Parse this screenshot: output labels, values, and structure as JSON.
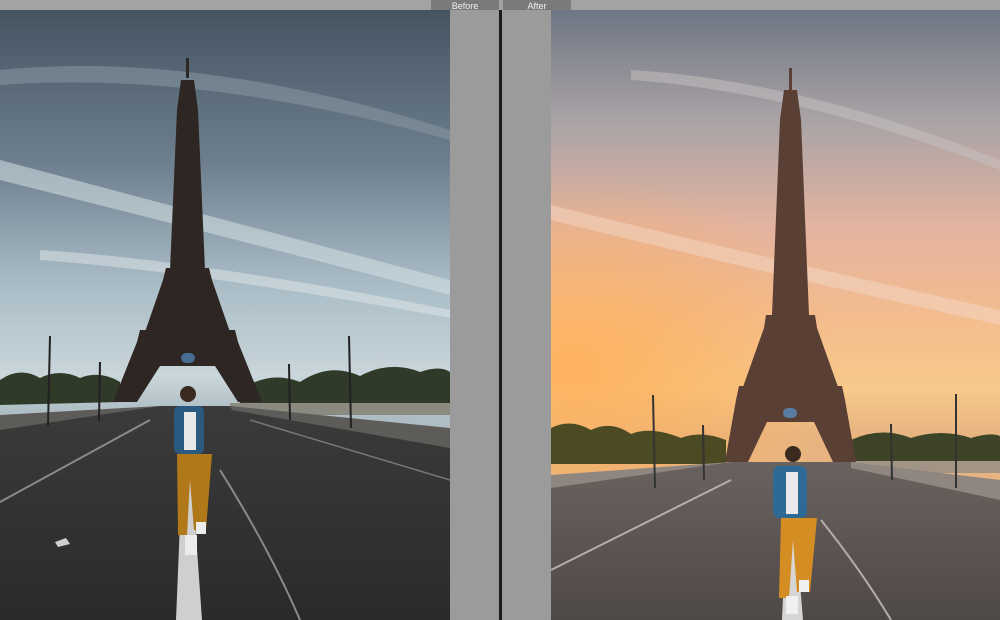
{
  "window": {
    "divider": "split-view-divider"
  },
  "compare": {
    "before_label": "Before",
    "after_label": "After"
  },
  "colors": {
    "ui_gray": "#9a9a9a",
    "label_bg": "#7a7a7a",
    "divider": "#1b1b1b",
    "before_sky_top": "#4a5865",
    "after_sky_glow": "#f6b97a"
  },
  "icons": {
    "before_photo": "photo-before",
    "after_photo": "photo-after"
  }
}
